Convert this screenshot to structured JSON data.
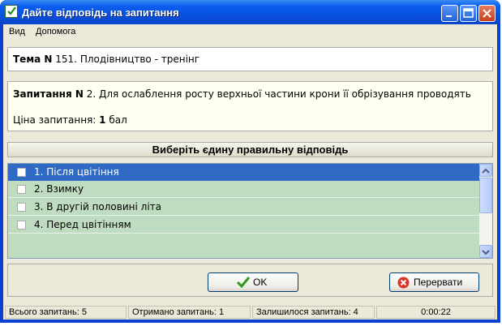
{
  "window": {
    "title": "Дайте відповідь на запитання"
  },
  "menu": {
    "items": [
      "Вид",
      "Допомога"
    ]
  },
  "theme": {
    "label": "Тема N",
    "text": "151. Плодівництво - тренінг"
  },
  "question": {
    "label": "Запитання N",
    "text": "2. Для ослаблення росту верхньої частини крони її обрізування проводять",
    "price_label": "Ціна запитання:",
    "price_value": "1",
    "price_unit": "бал"
  },
  "instruction": "Виберіть єдину правильну відповідь",
  "answers": [
    {
      "label": "1. Після цвітіння",
      "selected": true,
      "checked": false
    },
    {
      "label": "2. Взимку",
      "selected": false,
      "checked": false
    },
    {
      "label": "3. В другій половині літа",
      "selected": false,
      "checked": false
    },
    {
      "label": "4. Перед цвітінням",
      "selected": false,
      "checked": false
    }
  ],
  "buttons": {
    "ok": "OK",
    "abort": "Перервати"
  },
  "status": {
    "total": "Всього запитань: 5",
    "received": "Отримано запитань: 1",
    "remaining": "Залишилося запитань: 4",
    "time": "0:00:22"
  },
  "colors": {
    "title_bar": "#0a52e0",
    "selection": "#316ac5",
    "answers_bg": "#c0dcc0"
  },
  "icons": {
    "title": "check-icon",
    "ok": "green-check-icon",
    "abort": "red-x-icon"
  }
}
